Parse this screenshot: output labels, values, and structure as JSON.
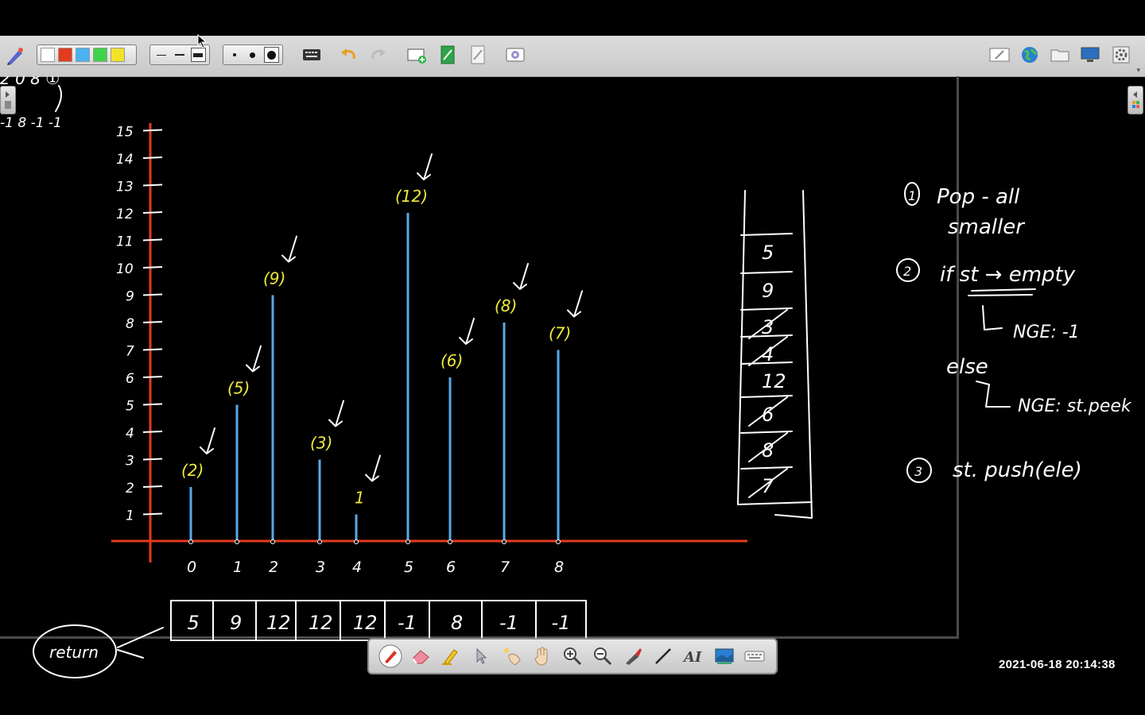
{
  "toolbar": {
    "colors": [
      "#ffffff",
      "#e53b1e",
      "#49b3f0",
      "#3fd447",
      "#f2e22a"
    ],
    "line_widths": [
      "thin",
      "medium",
      "thick"
    ],
    "dot_sizes": [
      "small",
      "medium",
      "large"
    ],
    "icons_left": [
      "keyboard-icon",
      "undo-icon",
      "redo-icon",
      "add-page-icon",
      "next-page-icon",
      "previous-page-icon",
      "screen-capture-icon"
    ],
    "icons_right": [
      "whiteboard-icon",
      "browser-icon",
      "folder-icon",
      "desktop-icon",
      "settings-icon"
    ]
  },
  "board": {
    "corner_note": "2 0 8 ①",
    "corner_values": "-1  8  -1  -1",
    "y_axis_ticks": [
      "1",
      "2",
      "3",
      "4",
      "5",
      "6",
      "7",
      "8",
      "9",
      "10",
      "11",
      "12",
      "13",
      "14",
      "15"
    ],
    "x_axis_ticks": [
      "0",
      "1",
      "2",
      "3",
      "4",
      "5",
      "6",
      "7",
      "8"
    ],
    "bar_labels": [
      "(2)",
      "(5)",
      "(9)",
      "(3)",
      "1",
      "(12)",
      "(6)",
      "(8)",
      "(7)"
    ],
    "bar_values": [
      2,
      5,
      9,
      3,
      1,
      12,
      6,
      8,
      7
    ],
    "result_cells": [
      "5",
      "9",
      "12",
      "12",
      "12",
      "-1",
      "8",
      "-1",
      "-1"
    ],
    "result_label": "return",
    "stack_items": [
      "5",
      "9",
      "3",
      "4",
      "12",
      "6",
      "8",
      "7"
    ],
    "stack_crossed": [
      false,
      false,
      true,
      true,
      false,
      true,
      true,
      true
    ],
    "steps": {
      "s1_num": "1",
      "s1_line1": "Pop - all",
      "s1_line2": "smaller",
      "s2_num": "2",
      "s2_line1": "if st → empty",
      "s2_line2": "NGE: -1",
      "else": "else",
      "s2_line3": "NGE: st.peek",
      "s3_num": "3",
      "s3_line1": "st. push(ele)"
    }
  },
  "bottom_toolbar": [
    "pen-icon",
    "eraser-icon",
    "highlighter-icon",
    "select-icon",
    "laser-pointer-icon",
    "hand-icon",
    "zoom-in-icon",
    "zoom-out-icon",
    "brush-icon",
    "line-icon",
    "text-icon",
    "background-icon",
    "keyboard-icon"
  ],
  "timestamp": "2021-06-18  20:14:38"
}
